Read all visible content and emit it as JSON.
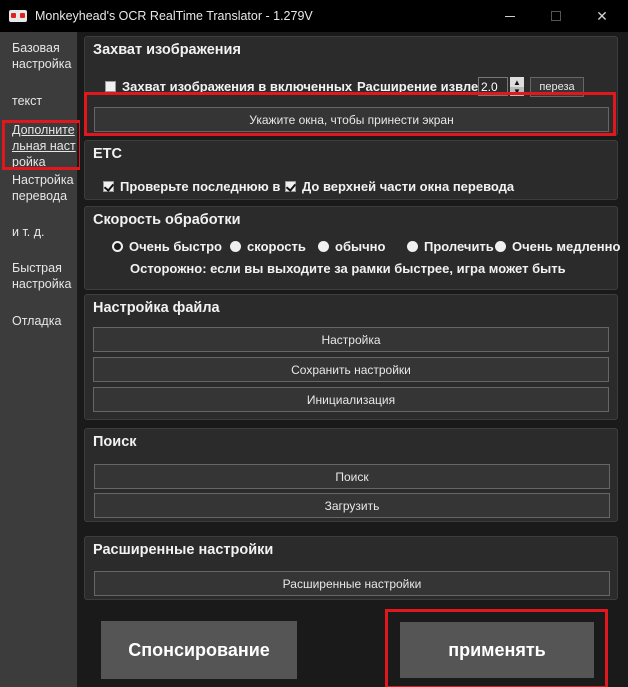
{
  "window": {
    "title": "Monkeyhead's OCR RealTime Translator - 1.279V",
    "minimize": "—",
    "maximize": "☐",
    "close": "✕"
  },
  "sidebar": {
    "items": [
      {
        "label": "Базовая настройка"
      },
      {
        "label": "текст"
      },
      {
        "label": "Дополнительная настройка"
      },
      {
        "label": "Настройка перевода"
      },
      {
        "label": "и т. д."
      },
      {
        "label": "Быстрая настройка"
      },
      {
        "label": "Отладка"
      }
    ],
    "active_index": 2
  },
  "capture": {
    "title": "Захват изображения",
    "checkbox_label": "Захват изображения в включенных",
    "checkbox_checked": false,
    "extension_label": "Расширение извле",
    "extension_value": "2.0",
    "reset_label": "переза",
    "select_window_label": "Укажите окна, чтобы принести экран"
  },
  "etc": {
    "title": "ETC",
    "check_last_label": "Проверьте последнюю в",
    "check_last_checked": true,
    "top_window_label": "До верхней части окна перевода",
    "top_window_checked": true
  },
  "speed": {
    "title": "Скорость обработки",
    "options": [
      "Очень быстро",
      "скорость",
      "обычно",
      "Пролечить",
      "Очень медленно"
    ],
    "selected_index": 0,
    "warning": "Осторожно: если вы выходите за рамки быстрее, игра может быть"
  },
  "file": {
    "title": "Настройка файла",
    "buttons": [
      "Настройка",
      "Сохранить настройки",
      "Инициализация"
    ]
  },
  "search": {
    "title": "Поиск",
    "buttons": [
      "Поиск",
      "Загрузить"
    ]
  },
  "advanced": {
    "title": "Расширенные настройки",
    "button": "Расширенные настройки"
  },
  "footer": {
    "sponsor_label": "Спонсирование",
    "apply_label": "применять"
  },
  "colors": {
    "highlight": "#e0181e",
    "panel": "#2b2b2b",
    "sidebar": "#3c3c3c"
  }
}
